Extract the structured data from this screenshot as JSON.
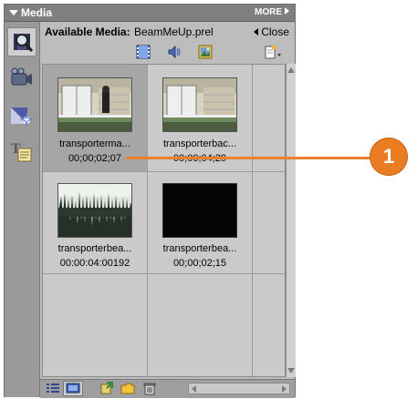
{
  "panel": {
    "title": "Media",
    "more_label": "MORE"
  },
  "header": {
    "label": "Available Media:",
    "project": "BeamMeUp.prel",
    "close_label": "Close"
  },
  "sidebar": {
    "items": [
      {
        "name": "media-magnifier-icon",
        "active": true
      },
      {
        "name": "video-camera-icon",
        "active": false
      },
      {
        "name": "effects-icon",
        "active": false
      },
      {
        "name": "titles-icon",
        "active": false
      }
    ]
  },
  "filters": [
    "film-strip-icon",
    "audio-speaker-icon",
    "still-image-icon",
    "new-item-icon"
  ],
  "media": [
    {
      "name": "transporterma...",
      "duration": "00;00;02;07",
      "type": "video",
      "selected": true
    },
    {
      "name": "transporterbac...",
      "duration": "00;00;04;29",
      "type": "video",
      "selected": false
    },
    {
      "name": "transporterbea...",
      "duration": "00:00:04:00192",
      "type": "audio",
      "selected": false
    },
    {
      "name": "transporterbea...",
      "duration": "00;00;02;15",
      "type": "black",
      "selected": false
    }
  ],
  "callout": {
    "number": "1",
    "color": "#EA7D22"
  },
  "colors": {
    "panel_bg": "#A9A9A9",
    "grid_bg": "#CACACA",
    "selected_cell": "#A6A6A6"
  }
}
